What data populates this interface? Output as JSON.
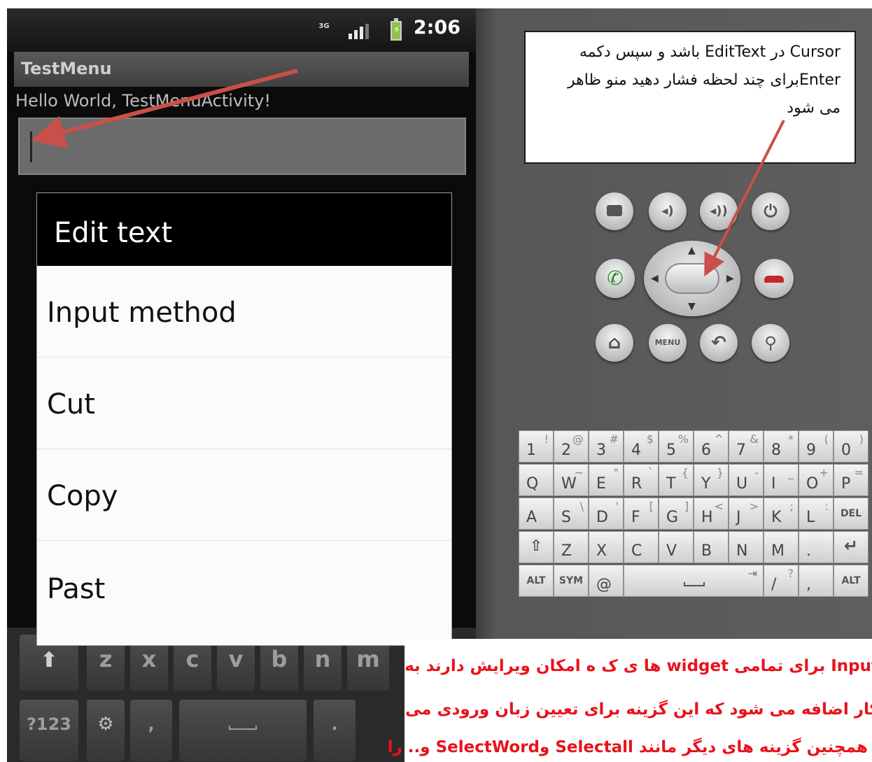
{
  "status_bar": {
    "network": "3G",
    "time": "2:06"
  },
  "app": {
    "title": "TestMenu",
    "hello_text": "Hello World, TestMenuActivity!"
  },
  "dialog": {
    "title": "Edit text",
    "items": [
      "Input method",
      "Cut",
      "Copy",
      "Past"
    ]
  },
  "soft_keyboard": {
    "row_letters": [
      "z",
      "x",
      "c",
      "v",
      "b",
      "n",
      "m"
    ],
    "sym_key": "?123",
    "comma_key": ",",
    "period_key": "."
  },
  "emulator": {
    "menu_button": "MENU",
    "keyboard": {
      "row1": [
        [
          "1",
          "!"
        ],
        [
          "2",
          "@"
        ],
        [
          "3",
          "#"
        ],
        [
          "4",
          "$"
        ],
        [
          "5",
          "%"
        ],
        [
          "6",
          "^"
        ],
        [
          "7",
          "&"
        ],
        [
          "8",
          "*"
        ],
        [
          "9",
          "("
        ],
        [
          "0",
          ")"
        ]
      ],
      "row2": [
        [
          "Q",
          ""
        ],
        [
          "W",
          "~"
        ],
        [
          "E",
          "\""
        ],
        [
          "R",
          "`"
        ],
        [
          "T",
          "{"
        ],
        [
          "Y",
          "}"
        ],
        [
          "U",
          "-"
        ],
        [
          "I",
          "_"
        ],
        [
          "O",
          "+"
        ],
        [
          "P",
          "="
        ]
      ],
      "row3": [
        [
          "A",
          ""
        ],
        [
          "S",
          "\\"
        ],
        [
          "D",
          "'"
        ],
        [
          "F",
          "["
        ],
        [
          "G",
          "]"
        ],
        [
          "H",
          "<"
        ],
        [
          "J",
          ">"
        ],
        [
          "K",
          ";"
        ],
        [
          "L",
          ":"
        ]
      ],
      "row3_del": "DEL",
      "row4": [
        "Z",
        "X",
        "C",
        "V",
        "B",
        "N",
        "M",
        "."
      ],
      "row5": {
        "alt_left": "ALT",
        "sym": "SYM",
        "at": "@",
        "slash": "/",
        "question": "?",
        "comma": ",",
        "alt_right": "ALT"
      }
    }
  },
  "note_box": {
    "line1": "Cursor در   EditText باشد و سپس دکمه",
    "line2": "Enterبرای چند لحظه فشار  دهید منو ظاهر",
    "line3": "می شود"
  },
  "bottom_note": {
    "line1": "Input برای تمامی  widget ها ی ک ه امکان ویرایش دارند  به",
    "line2": "کار اضافه می شود که این گزینه برای تعیین زبان ورودی می",
    "line3": "همچنین گزینه های دیگر مانند Selectall وSelectWord و.. را"
  },
  "colors": {
    "arrow": "#c9504a",
    "note_text": "#e8131c",
    "dialog_header": "#000000"
  }
}
